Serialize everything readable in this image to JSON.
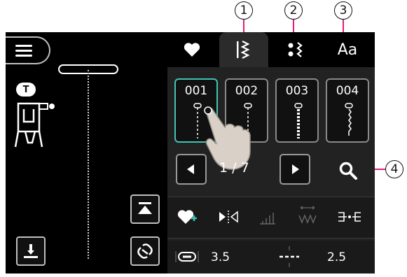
{
  "callouts": [
    {
      "number": "1"
    },
    {
      "number": "2"
    },
    {
      "number": "3"
    },
    {
      "number": "4"
    }
  ],
  "left_panel": {
    "presser_foot_badge": "T"
  },
  "tabs": [
    {
      "name": "favorites",
      "icon": "heart-icon"
    },
    {
      "name": "utility-stitches",
      "icon": "stitch-icon",
      "active": true
    },
    {
      "name": "decorative-stitches",
      "icon": "decorative-stitch-icon"
    },
    {
      "name": "alphabet",
      "label": "Aa"
    }
  ],
  "stitches": [
    {
      "number": "001",
      "selected": true
    },
    {
      "number": "002"
    },
    {
      "number": "003"
    },
    {
      "number": "004"
    }
  ],
  "pager": {
    "current": "1",
    "separator": "/",
    "total": "7"
  },
  "function_icons": [
    "heart-plus-icon",
    "mirror-icon",
    "elongation-icon",
    "density-icon",
    "connect-icon"
  ],
  "settings": {
    "stitch_width": "3.5",
    "stitch_length": "2.5"
  },
  "colors": {
    "screen_background": "#000000",
    "selected_accent": "#3fc4b4",
    "callout_line": "#e31c79"
  }
}
